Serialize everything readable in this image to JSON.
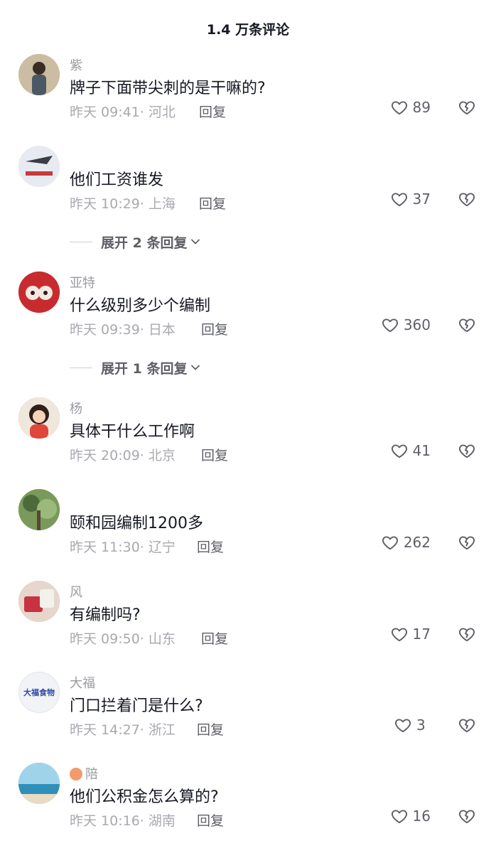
{
  "header": {
    "title": "1.4 万条评论"
  },
  "comments": [
    {
      "nickname": "紫",
      "content": "牌子下面带尖刺的是干嘛的?",
      "meta": "昨天 09:41· 河北",
      "reply": "回复",
      "likes": "89",
      "avatar_color": "#c9b89b",
      "avatar_text": ""
    },
    {
      "nickname": "",
      "content": "他们工资谁发",
      "meta": "昨天 10:29· 上海",
      "reply": "回复",
      "likes": "37",
      "avatar_color": "#dfe3ea",
      "avatar_text": ""
    },
    {
      "nickname": "亚特",
      "content": "什么级别多少个编制",
      "meta": "昨天 09:39· 日本",
      "reply": "回复",
      "likes": "360",
      "avatar_color": "#c7262d",
      "avatar_text": ""
    },
    {
      "nickname": "杨",
      "content": "具体干什么工作啊",
      "meta": "昨天 20:09· 北京",
      "reply": "回复",
      "likes": "41",
      "avatar_color": "#e0463a",
      "avatar_text": ""
    },
    {
      "nickname": "",
      "content": "颐和园编制1200多",
      "meta": "昨天 11:30· 辽宁",
      "reply": "回复",
      "likes": "262",
      "avatar_color": "#6e8f56",
      "avatar_text": ""
    },
    {
      "nickname": "风",
      "content": "有编制吗?",
      "meta": "昨天 09:50· 山东",
      "reply": "回复",
      "likes": "17",
      "avatar_color": "#d7b3a8",
      "avatar_text": ""
    },
    {
      "nickname": "大福",
      "content": "门口拦着门是什么?",
      "meta": "昨天 14:27· 浙江",
      "reply": "回复",
      "likes": "3",
      "avatar_color": "#f2f3f6",
      "avatar_text": "大福食物"
    },
    {
      "nickname": "陪",
      "content": "他们公积金怎么算的?",
      "meta": "昨天 10:16· 湖南",
      "reply": "回复",
      "likes": "16",
      "avatar_color": "#5aa9c9",
      "avatar_text": ""
    }
  ],
  "expand_replies": [
    {
      "label": "展开 2 条回复"
    },
    {
      "label": "展开 1 条回复"
    }
  ],
  "icons": {
    "like": "heart-outline-icon",
    "dislike": "broken-heart-icon",
    "expand": "chevron-down-icon"
  },
  "colors": {
    "text_primary": "#161823",
    "text_secondary": "#a8a9ae",
    "nickname": "#9a9ba1",
    "action": "#5e5f66"
  }
}
